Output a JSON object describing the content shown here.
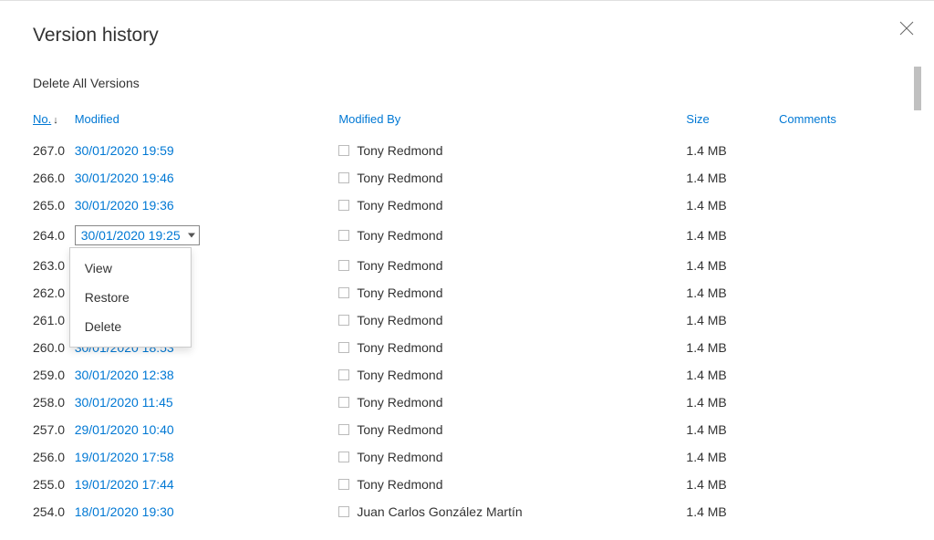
{
  "title": "Version history",
  "delete_all": "Delete All Versions",
  "columns": {
    "no": "No.",
    "modified": "Modified",
    "modified_by": "Modified By",
    "size": "Size",
    "comments": "Comments"
  },
  "dropdown": {
    "trigger_text": "30/01/2020 19:25",
    "items": {
      "view": "View",
      "restore": "Restore",
      "delete": "Delete"
    }
  },
  "versions": [
    {
      "no": "267.0",
      "modified": "30/01/2020 19:59",
      "modified_by": "Tony Redmond",
      "size": "1.4 MB",
      "has_dropdown": false
    },
    {
      "no": "266.0",
      "modified": "30/01/2020 19:46",
      "modified_by": "Tony Redmond",
      "size": "1.4 MB",
      "has_dropdown": false
    },
    {
      "no": "265.0",
      "modified": "30/01/2020 19:36",
      "modified_by": "Tony Redmond",
      "size": "1.4 MB",
      "has_dropdown": false
    },
    {
      "no": "264.0",
      "modified": "30/01/2020 19:25",
      "modified_by": "Tony Redmond",
      "size": "1.4 MB",
      "has_dropdown": true
    },
    {
      "no": "263.0",
      "modified": "",
      "modified_by": "Tony Redmond",
      "size": "1.4 MB",
      "has_dropdown": false
    },
    {
      "no": "262.0",
      "modified": "",
      "modified_by": "Tony Redmond",
      "size": "1.4 MB",
      "has_dropdown": false
    },
    {
      "no": "261.0",
      "modified": "",
      "modified_by": "Tony Redmond",
      "size": "1.4 MB",
      "has_dropdown": false
    },
    {
      "no": "260.0",
      "modified": "30/01/2020 18:53",
      "modified_by": "Tony Redmond",
      "size": "1.4 MB",
      "has_dropdown": false
    },
    {
      "no": "259.0",
      "modified": "30/01/2020 12:38",
      "modified_by": "Tony Redmond",
      "size": "1.4 MB",
      "has_dropdown": false
    },
    {
      "no": "258.0",
      "modified": "30/01/2020 11:45",
      "modified_by": "Tony Redmond",
      "size": "1.4 MB",
      "has_dropdown": false
    },
    {
      "no": "257.0",
      "modified": "29/01/2020 10:40",
      "modified_by": "Tony Redmond",
      "size": "1.4 MB",
      "has_dropdown": false
    },
    {
      "no": "256.0",
      "modified": "19/01/2020 17:58",
      "modified_by": "Tony Redmond",
      "size": "1.4 MB",
      "has_dropdown": false
    },
    {
      "no": "255.0",
      "modified": "19/01/2020 17:44",
      "modified_by": "Tony Redmond",
      "size": "1.4 MB",
      "has_dropdown": false
    },
    {
      "no": "254.0",
      "modified": "18/01/2020 19:30",
      "modified_by": "Juan Carlos González Martín",
      "size": "1.4 MB",
      "has_dropdown": false
    }
  ]
}
